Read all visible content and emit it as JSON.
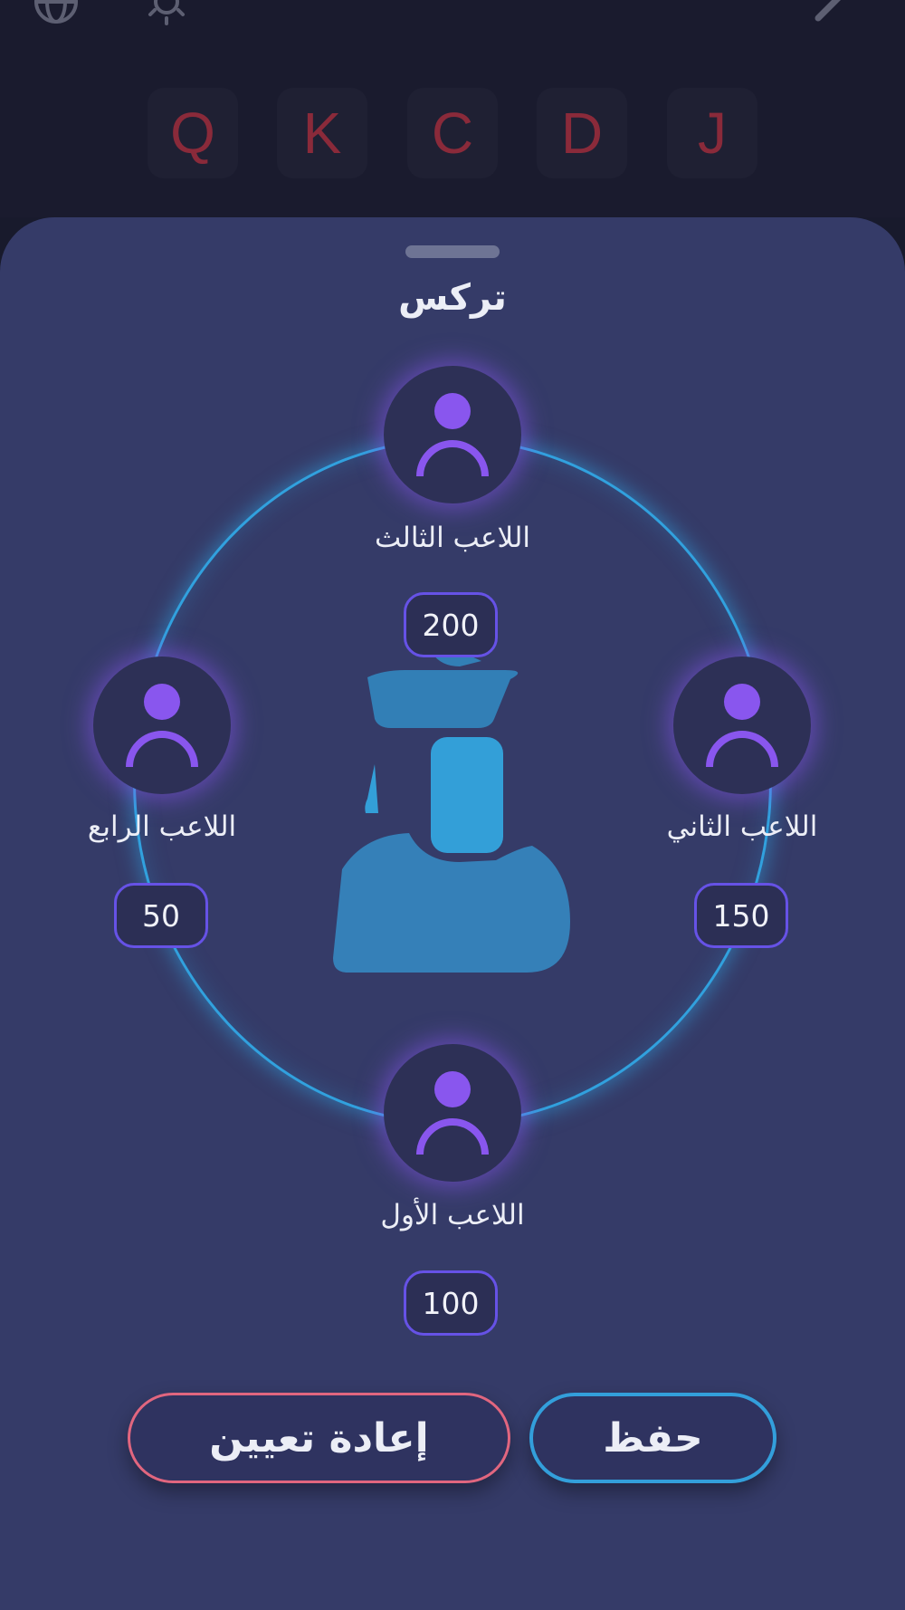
{
  "top_icons": [
    "globe-icon",
    "sun-icon",
    "pencil-icon"
  ],
  "cards": [
    "Q",
    "K",
    "C",
    "D",
    "J"
  ],
  "sheet": {
    "title": "تركس"
  },
  "players": [
    {
      "name": "اللاعب الأول",
      "score": "100"
    },
    {
      "name": "اللاعب الثاني",
      "score": "150"
    },
    {
      "name": "اللاعب الثالث",
      "score": "200"
    },
    {
      "name": "اللاعب الرابع",
      "score": "50"
    }
  ],
  "actions": {
    "reset_label": "إعادة تعيين",
    "save_label": "حفظ"
  },
  "colors": {
    "background": "#181a2c",
    "sheet": "#353b68",
    "accent_purple": "#8956ee",
    "ring_blue": "#31a1de",
    "reset_border": "#e1667f",
    "card_letter": "#8a2a3a"
  }
}
